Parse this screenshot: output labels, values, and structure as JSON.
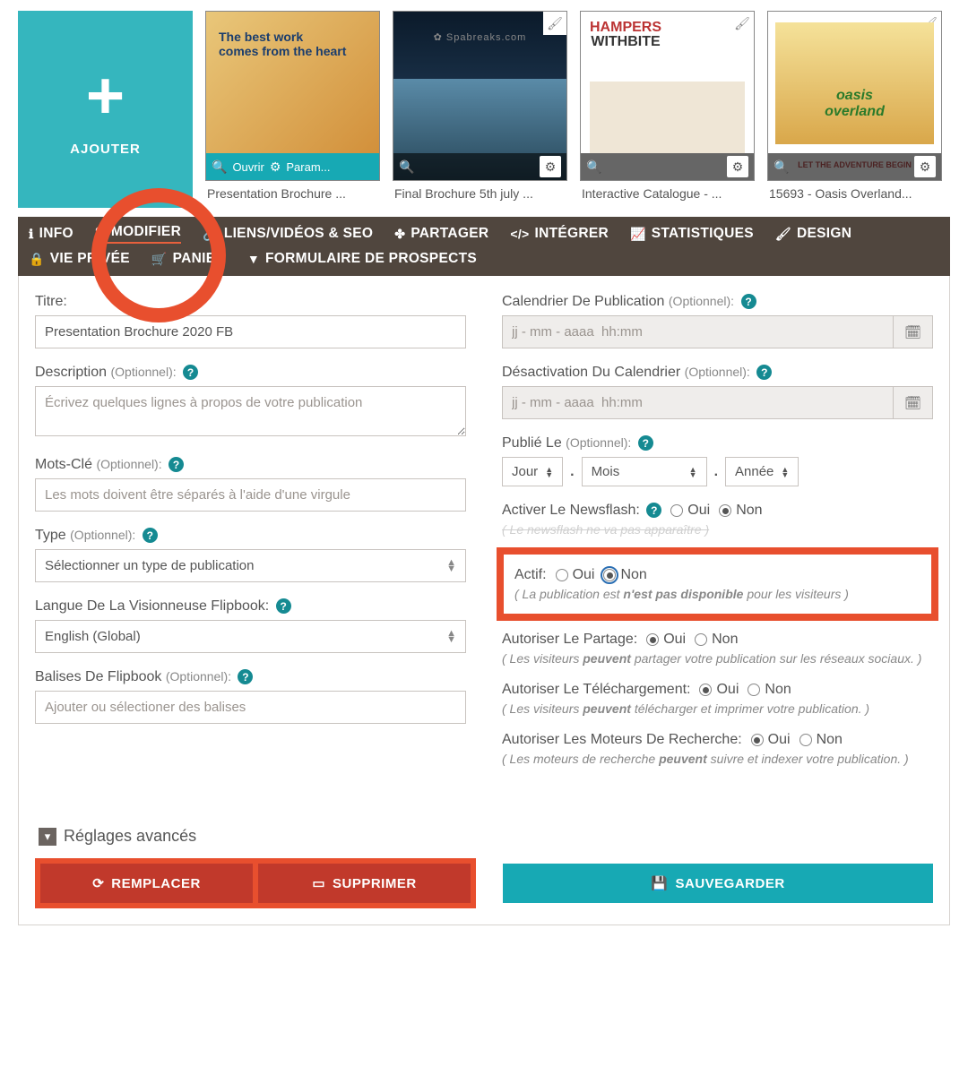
{
  "add_tile": {
    "label": "AJOUTER"
  },
  "thumbs": [
    {
      "title": "Presentation Brochure ...",
      "open": "Ouvrir",
      "param": "Param...",
      "cover_line1": "The best work",
      "cover_line2": "comes from the heart"
    },
    {
      "title": "Final Brochure 5th july ...",
      "brand": "✿ Spabreaks.com"
    },
    {
      "title": "Interactive Catalogue - ...",
      "hdr1": "HAMPERS",
      "hdr2": "WITHBITE"
    },
    {
      "title": "15693 - Oasis Overland...",
      "logo": "oasis overland",
      "band": "LET THE ADVENTURE BEGIN"
    }
  ],
  "tabs": {
    "info": "INFO",
    "modifier": "MODIFIER",
    "liens": "LIENS/VIDÉOS & SEO",
    "partager": "PARTAGER",
    "integrer": "INTÉGRER",
    "stats": "STATISTIQUES",
    "design": "DESIGN",
    "vieprivee": "VIE PRIVÉE",
    "panier": "PANIER",
    "formulaire": "FORMULAIRE DE PROSPECTS"
  },
  "form": {
    "titre_label": "Titre:",
    "titre_value": "Presentation Brochure 2020 FB",
    "desc_label": "Description",
    "desc_ph": "Écrivez quelques lignes à propos de votre publication",
    "mots_label": "Mots-Clé",
    "mots_ph": "Les mots doivent être séparés à l'aide d'une virgule",
    "type_label": "Type",
    "type_value": "Sélectionner un type de publication",
    "lang_label": "Langue De La Visionneuse Flipbook:",
    "lang_value": "English (Global)",
    "balises_label": "Balises De Flipbook",
    "balises_ph": "Ajouter ou sélectioner des balises",
    "optionnel": "(Optionnel):",
    "cal_label": "Calendrier De Publication",
    "cal_ph": "jj - mm - aaaa  hh:mm",
    "desact_label": "Désactivation Du Calendrier",
    "publie_label": "Publié Le",
    "jour": "Jour",
    "mois": "Mois",
    "annee": "Année",
    "newsflash_label": "Activer Le Newsflash:",
    "newsflash_hint": "( Le newsflash ne va pas apparaître )",
    "actif_label": "Actif:",
    "actif_hint_pre": "( La publication est ",
    "actif_hint_b": "n'est pas disponible",
    "actif_hint_post": " pour les visiteurs )",
    "partage_label": "Autoriser Le Partage:",
    "partage_hint_pre": "( Les visiteurs ",
    "partage_hint_b": "peuvent",
    "partage_hint_post": " partager votre publication sur les réseaux sociaux. )",
    "dl_label": "Autoriser Le Téléchargement:",
    "dl_hint_pre": "( Les visiteurs ",
    "dl_hint_b": "peuvent",
    "dl_hint_post": " télécharger et imprimer votre publication. )",
    "search_label": "Autoriser Les Moteurs De Recherche:",
    "search_hint_pre": "( Les moteurs de recherche ",
    "search_hint_b": "peuvent",
    "search_hint_post": " suivre et indexer votre publication. )",
    "oui": "Oui",
    "non": "Non",
    "adv": "Réglages avancés",
    "replace": "REMPLACER",
    "delete": "SUPPRIMER",
    "save": "SAUVEGARDER"
  }
}
